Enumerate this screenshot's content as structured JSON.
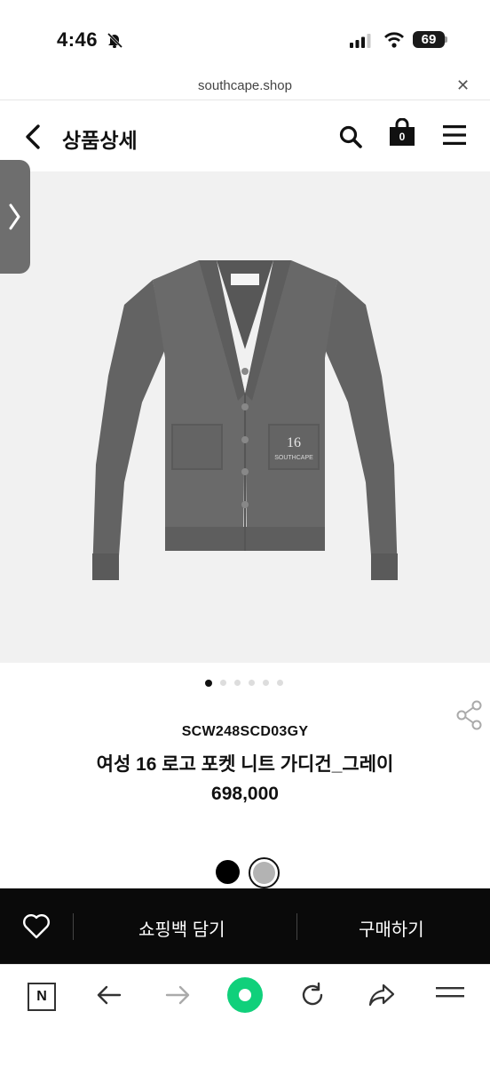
{
  "status_bar": {
    "time": "4:46",
    "battery": "69"
  },
  "url_bar": {
    "url": "southcape.shop",
    "close_icon": "close-icon"
  },
  "header": {
    "title": "상품상세",
    "cart_count": "0"
  },
  "product": {
    "code": "SCW248SCD03GY",
    "name": "여성 16 로고 포켓 니트 가디건_그레이",
    "price": "698,000",
    "image_count": 6,
    "active_image": 1,
    "colors": [
      "#000000",
      "#b3b3b3"
    ],
    "selected_color": 2,
    "image_text": {
      "number": "16",
      "brand": "SOUTHCAPE"
    }
  },
  "actions": {
    "cart_label": "쇼핑백 담기",
    "buy_label": "구매하기"
  },
  "icons": {
    "back": "chevron-left-icon",
    "search": "search-icon",
    "cart": "shopping-bag-icon",
    "menu": "menu-icon",
    "share": "share-icon",
    "heart": "heart-icon",
    "nav_back": "arrow-left-icon",
    "nav_forward": "arrow-right-icon",
    "reload": "reload-icon",
    "share_forward": "forward-share-icon",
    "browser_menu": "hamburger-icon"
  }
}
